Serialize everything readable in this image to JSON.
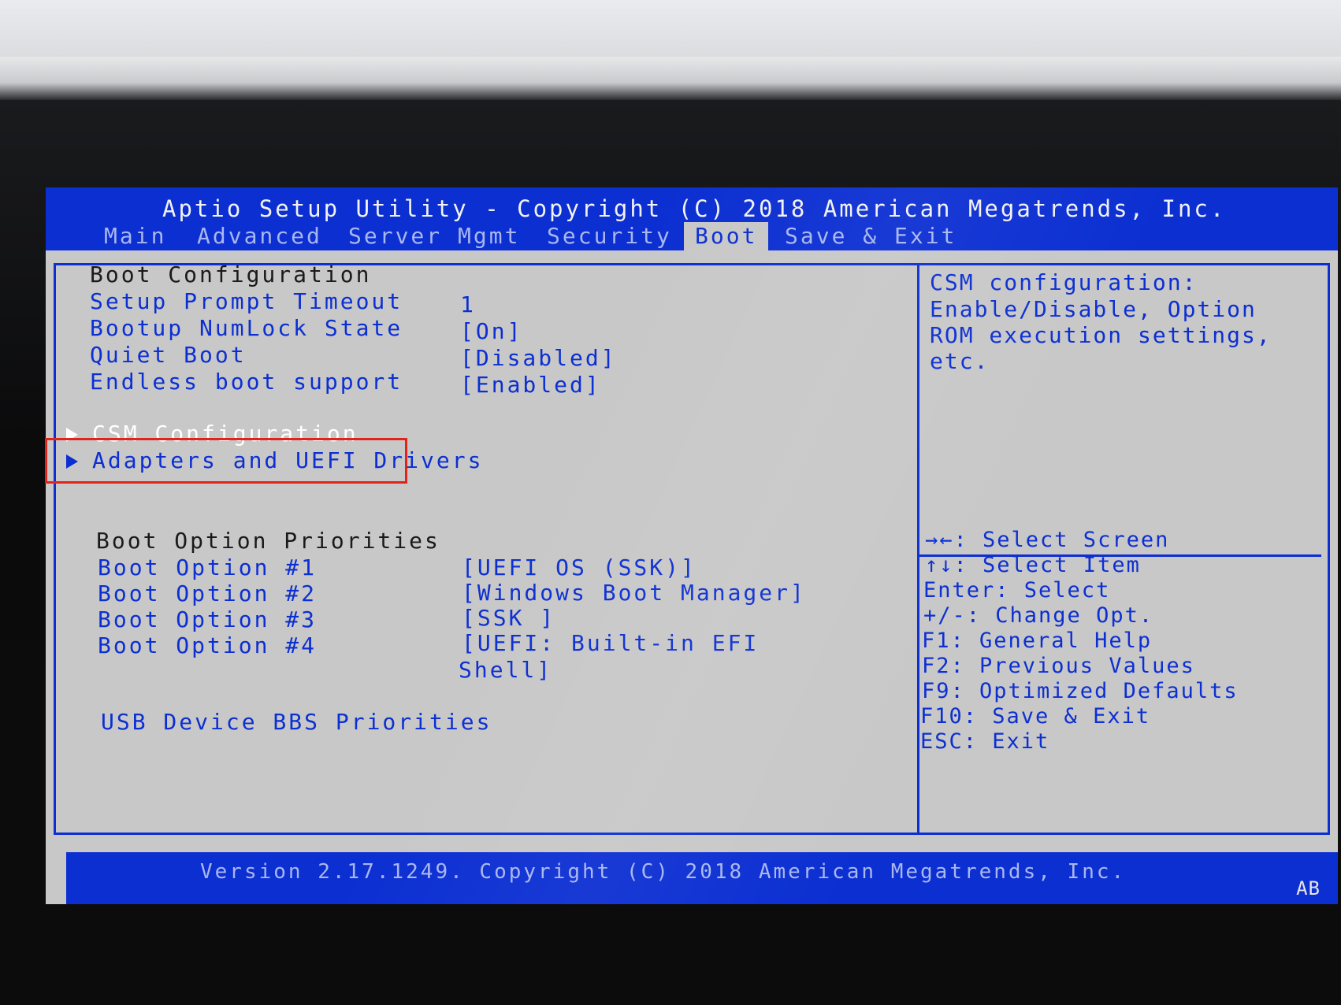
{
  "title": "Aptio Setup Utility - Copyright (C) 2018 American Megatrends, Inc.",
  "tabs": [
    {
      "label": "Main",
      "active": false
    },
    {
      "label": "Advanced",
      "active": false
    },
    {
      "label": "Server Mgmt",
      "active": false
    },
    {
      "label": "Security",
      "active": false
    },
    {
      "label": "Boot",
      "active": true
    },
    {
      "label": "Save & Exit",
      "active": false
    }
  ],
  "boot_config": {
    "header": "Boot Configuration",
    "items": [
      {
        "label": "Setup Prompt Timeout",
        "value": "1"
      },
      {
        "label": "Bootup NumLock State",
        "value": "[On]"
      },
      {
        "label": "Quiet Boot",
        "value": "[Disabled]"
      },
      {
        "label": "Endless boot support",
        "value": "[Enabled]"
      }
    ]
  },
  "submenus": [
    {
      "label": "CSM Configuration",
      "selected": true
    },
    {
      "label": "Adapters and UEFI Drivers",
      "selected": false
    }
  ],
  "boot_priorities": {
    "header": "Boot Option Priorities",
    "items": [
      {
        "label": "Boot Option #1",
        "value": "[UEFI OS (SSK)]"
      },
      {
        "label": "Boot Option #2",
        "value": "[Windows Boot Manager]"
      },
      {
        "label": "Boot Option #3",
        "value": "[SSK ]"
      },
      {
        "label": "Boot Option #4",
        "value": "[UEFI: Built-in EFI",
        "value_cont": "Shell]"
      }
    ]
  },
  "usb_bbs": "USB Device BBS Priorities",
  "help": {
    "lines": [
      "CSM configuration:",
      "Enable/Disable, Option",
      "ROM execution settings,",
      "etc."
    ]
  },
  "keys": [
    "→←: Select Screen",
    "↑↓: Select Item",
    "Enter: Select",
    "+/-: Change Opt.",
    "F1: General Help",
    "F2: Previous Values",
    "F9: Optimized Defaults",
    "F10: Save & Exit",
    "ESC: Exit"
  ],
  "footer": {
    "text": "Version 2.17.1249. Copyright (C) 2018 American Megatrends, Inc.",
    "badge": "AB"
  },
  "colors": {
    "bios_blue": "#0c2fd2",
    "panel_gray": "#c8c8c8",
    "highlight_red": "#e2231a"
  }
}
